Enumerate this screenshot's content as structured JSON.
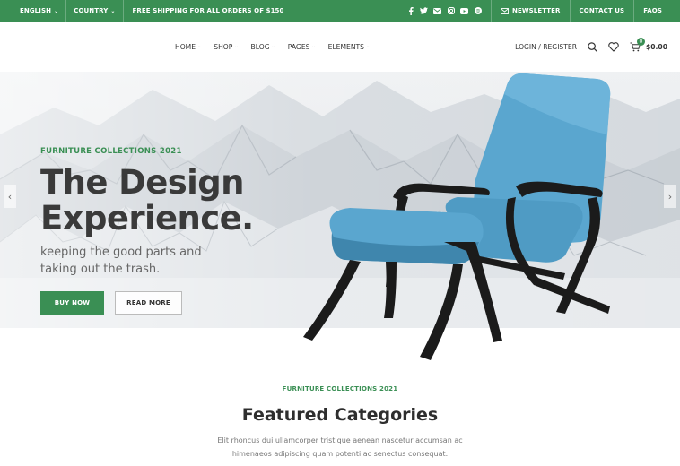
{
  "topbar": {
    "language": "ENGLISH",
    "country": "COUNTRY",
    "shipping": "FREE SHIPPING FOR ALL ORDERS OF $150",
    "newsletter": "NEWSLETTER",
    "contact": "CONTACT US",
    "faqs": "FAQS",
    "social_icons": [
      "facebook-icon",
      "twitter-icon",
      "email-icon",
      "instagram-icon",
      "youtube-icon",
      "spotify-icon"
    ],
    "bg_color": "#3a8f54"
  },
  "nav": {
    "items": [
      {
        "label": "HOME"
      },
      {
        "label": "SHOP"
      },
      {
        "label": "BLOG"
      },
      {
        "label": "PAGES"
      },
      {
        "label": "ELEMENTS"
      }
    ],
    "login": "LOGIN / REGISTER",
    "cart_count": "0",
    "cart_total": "$0.00"
  },
  "hero": {
    "kicker": "FURNITURE COLLECTIONS 2021",
    "title": "The Design Experience.",
    "subtitle": "keeping the good parts and taking out the trash.",
    "buy_label": "BUY NOW",
    "more_label": "READ MORE",
    "prev_arrow": "‹",
    "next_arrow": "›"
  },
  "featured": {
    "kicker": "FURNITURE COLLECTIONS 2021",
    "title": "Featured Categories",
    "description": "Elit rhoncus dui ullamcorper tristique aenean nascetur accumsan ac himenaeos adipiscing quam potenti ac senectus consequat."
  },
  "colors": {
    "accent": "#3a8f54",
    "chair_blue": "#5aa6cf"
  }
}
